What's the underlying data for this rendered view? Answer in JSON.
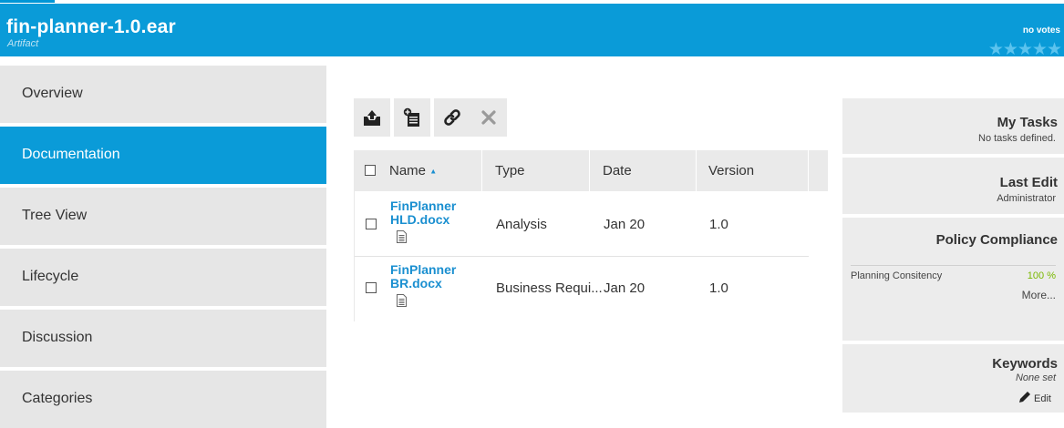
{
  "header": {
    "title": "fin-planner-1.0.ear",
    "subtitle": "Artifact",
    "votes_label": "no votes",
    "stars": "★★★★★"
  },
  "sidebar": {
    "items": [
      {
        "label": "Overview",
        "active": false
      },
      {
        "label": "Documentation",
        "active": true
      },
      {
        "label": "Tree View",
        "active": false
      },
      {
        "label": "Lifecycle",
        "active": false
      },
      {
        "label": "Discussion",
        "active": false
      },
      {
        "label": "Categories",
        "active": false
      }
    ]
  },
  "toolbar": {
    "buttons": [
      {
        "icon": "upload-icon"
      },
      {
        "icon": "new-document-icon"
      },
      {
        "icon": "link-icon"
      },
      {
        "icon": "delete-icon"
      }
    ]
  },
  "table": {
    "columns": {
      "name": "Name",
      "sort_indicator": "▲",
      "type": "Type",
      "date": "Date",
      "version": "Version"
    },
    "rows": [
      {
        "name_line1": "FinPlanner",
        "name_line2": "HLD.docx",
        "type": "Analysis",
        "date": "Jan 20",
        "version": "1.0"
      },
      {
        "name_line1": "FinPlanner",
        "name_line2": "BR.docx",
        "type": "Business Requi...",
        "date": "Jan 20",
        "version": "1.0"
      }
    ]
  },
  "right_panel": {
    "my_tasks": {
      "title": "My Tasks",
      "value": "No tasks defined."
    },
    "last_edit": {
      "title": "Last Edit",
      "value": "Administrator"
    },
    "policy": {
      "title": "Policy Compliance",
      "item_label": "Planning Consitency",
      "item_value": "100 %",
      "more": "More..."
    },
    "keywords": {
      "title": "Keywords",
      "value": "None set",
      "edit": "Edit"
    }
  },
  "colors": {
    "brand": "#0a9bd8",
    "link": "#1a8fd0",
    "success": "#7ab800"
  }
}
